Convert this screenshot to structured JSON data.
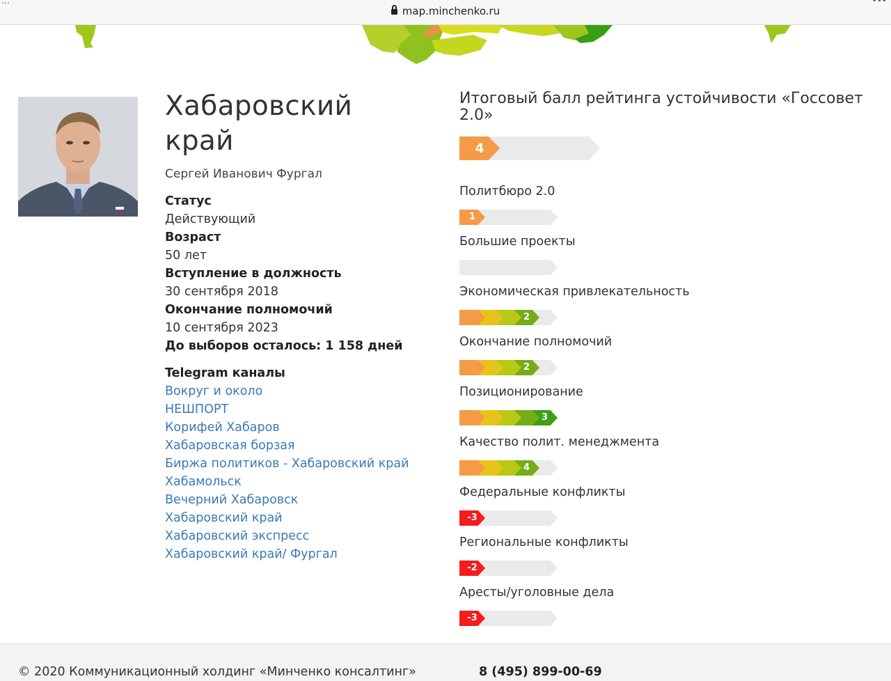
{
  "browser": {
    "url": "map.minchenko.ru"
  },
  "region": {
    "name": "Хабаровский край",
    "person": "Сергей Иванович Фургал",
    "fields": [
      {
        "label": "Статус",
        "value": "Действующий"
      },
      {
        "label": "Возраст",
        "value": "50 лет"
      },
      {
        "label": "Вступление в должность",
        "value": "30 сентября 2018"
      },
      {
        "label": "Окончание полномочий",
        "value": "10 сентября 2023"
      }
    ],
    "election_countdown": "До выборов осталось: 1 158 дней"
  },
  "telegram": {
    "title": "Telegram каналы",
    "channels": [
      "Вокруг и около",
      "НЕШПОРТ",
      "Корифей Хабаров",
      "Хабаровская борзая",
      "Биржа политиков - Хабаровский край",
      "Хабамольск",
      "Вечерний Хабаровск",
      "Хабаровский край",
      "Хабаровский экспресс",
      "Хабаровский край/ Фургал"
    ]
  },
  "colors": {
    "empty": "#eaeaea",
    "orange": "#f59a46",
    "yellow": "#e8c41a",
    "lime": "#b7c816",
    "green": "#74ad16",
    "darkgreen": "#3e9e14",
    "red": "#f21d1d",
    "link": "#3a79b8"
  },
  "rating": {
    "total_title": "Итоговый балл рейтинга устойчивости «Госсовет 2.0»",
    "total": {
      "value": "4",
      "segments": [
        "orange",
        "empty",
        "empty",
        "empty",
        "empty"
      ],
      "label_pos": 0
    },
    "categories": [
      {
        "name": "Политбюро 2.0",
        "value": "1",
        "segments": [
          "orange",
          "empty",
          "empty",
          "empty",
          "empty"
        ],
        "label_pos": 0
      },
      {
        "name": "Большие проекты",
        "value": "",
        "segments": [
          "empty",
          "empty",
          "empty",
          "empty",
          "empty"
        ],
        "label_pos": 0
      },
      {
        "name": "Экономическая привлекательность",
        "value": "2",
        "segments": [
          "orange",
          "yellow",
          "lime",
          "green",
          "empty"
        ],
        "label_pos": 3
      },
      {
        "name": "Окончание полномочий",
        "value": "2",
        "segments": [
          "orange",
          "yellow",
          "lime",
          "green",
          "empty"
        ],
        "label_pos": 3
      },
      {
        "name": "Позиционирование",
        "value": "3",
        "segments": [
          "orange",
          "yellow",
          "lime",
          "green",
          "darkgreen"
        ],
        "label_pos": 4
      },
      {
        "name": "Качество полит. менеджмента",
        "value": "4",
        "segments": [
          "orange",
          "yellow",
          "lime",
          "green",
          "empty"
        ],
        "label_pos": 3
      },
      {
        "name": "Федеральные конфликты",
        "value": "-3",
        "segments": [
          "red",
          "empty",
          "empty",
          "empty",
          "empty"
        ],
        "label_pos": 0
      },
      {
        "name": "Региональные конфликты",
        "value": "-2",
        "segments": [
          "red",
          "empty",
          "empty",
          "empty",
          "empty"
        ],
        "label_pos": 0
      },
      {
        "name": "Аресты/уголовные дела",
        "value": "-3",
        "segments": [
          "red",
          "empty",
          "empty",
          "empty",
          "empty"
        ],
        "label_pos": 0
      }
    ]
  },
  "footer": {
    "copyright": "© 2020 Коммуникационный холдинг «Минченко консалтинг»",
    "phone": "8 (495) 899-00-69"
  }
}
